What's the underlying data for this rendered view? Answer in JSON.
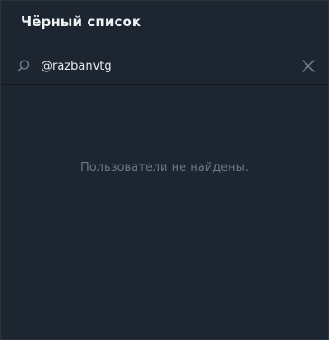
{
  "window": {
    "title": "Чёрный список"
  },
  "search": {
    "value": "@razbanvtg",
    "search_icon": "search-icon",
    "clear_icon": "close-icon"
  },
  "results": {
    "empty_message": "Пользователи не найдены."
  },
  "colors": {
    "background": "#1d2530",
    "title_text": "#f1f3f5",
    "muted_text": "#6c7883",
    "icon": "#6c7883"
  }
}
